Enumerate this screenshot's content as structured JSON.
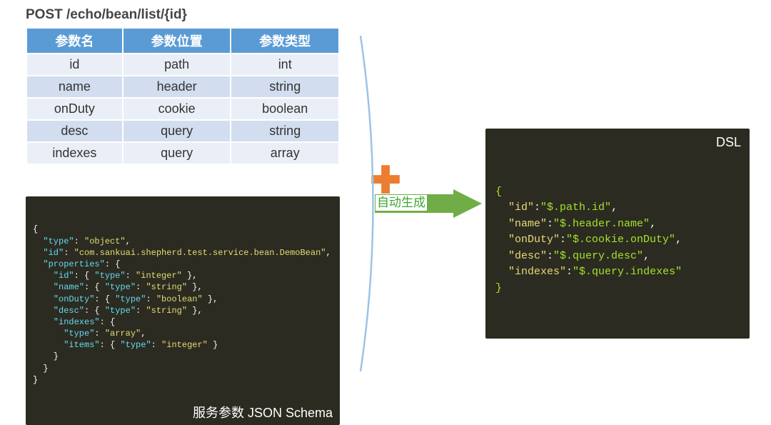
{
  "api_title": "POST /echo/bean/list/{id}",
  "table": {
    "headers": [
      "参数名",
      "参数位置",
      "参数类型"
    ],
    "rows": [
      {
        "name": "id",
        "location": "path",
        "type": "int"
      },
      {
        "name": "name",
        "location": "header",
        "type": "string"
      },
      {
        "name": "onDuty",
        "location": "cookie",
        "type": "boolean"
      },
      {
        "name": "desc",
        "location": "query",
        "type": "string"
      },
      {
        "name": "indexes",
        "location": "query",
        "type": "array"
      }
    ]
  },
  "plus_symbol": "✚",
  "json_schema": {
    "label": "服务参数 JSON Schema",
    "lines": [
      [
        {
          "t": "{",
          "c": "brace"
        }
      ],
      [
        {
          "t": "  \"type\"",
          "c": "key"
        },
        {
          "t": ": ",
          "c": "punct"
        },
        {
          "t": "\"object\"",
          "c": "str"
        },
        {
          "t": ",",
          "c": "punct"
        }
      ],
      [
        {
          "t": "  \"id\"",
          "c": "key"
        },
        {
          "t": ": ",
          "c": "punct"
        },
        {
          "t": "\"com.sankuai.shepherd.test.service.bean.DemoBean\"",
          "c": "str"
        },
        {
          "t": ",",
          "c": "punct"
        }
      ],
      [
        {
          "t": "  \"properties\"",
          "c": "key"
        },
        {
          "t": ": {",
          "c": "punct"
        }
      ],
      [
        {
          "t": "    \"id\"",
          "c": "key"
        },
        {
          "t": ": { ",
          "c": "punct"
        },
        {
          "t": "\"type\"",
          "c": "key"
        },
        {
          "t": ": ",
          "c": "punct"
        },
        {
          "t": "\"integer\"",
          "c": "str"
        },
        {
          "t": " },",
          "c": "punct"
        }
      ],
      [
        {
          "t": "    \"name\"",
          "c": "key"
        },
        {
          "t": ": { ",
          "c": "punct"
        },
        {
          "t": "\"type\"",
          "c": "key"
        },
        {
          "t": ": ",
          "c": "punct"
        },
        {
          "t": "\"string\"",
          "c": "str"
        },
        {
          "t": " },",
          "c": "punct"
        }
      ],
      [
        {
          "t": "    \"onDuty\"",
          "c": "key"
        },
        {
          "t": ": { ",
          "c": "punct"
        },
        {
          "t": "\"type\"",
          "c": "key"
        },
        {
          "t": ": ",
          "c": "punct"
        },
        {
          "t": "\"boolean\"",
          "c": "str"
        },
        {
          "t": " },",
          "c": "punct"
        }
      ],
      [
        {
          "t": "    \"desc\"",
          "c": "key"
        },
        {
          "t": ": { ",
          "c": "punct"
        },
        {
          "t": "\"type\"",
          "c": "key"
        },
        {
          "t": ": ",
          "c": "punct"
        },
        {
          "t": "\"string\"",
          "c": "str"
        },
        {
          "t": " },",
          "c": "punct"
        }
      ],
      [
        {
          "t": "    \"indexes\"",
          "c": "key"
        },
        {
          "t": ": {",
          "c": "punct"
        }
      ],
      [
        {
          "t": "      \"type\"",
          "c": "key"
        },
        {
          "t": ": ",
          "c": "punct"
        },
        {
          "t": "\"array\"",
          "c": "str"
        },
        {
          "t": ",",
          "c": "punct"
        }
      ],
      [
        {
          "t": "      \"items\"",
          "c": "key"
        },
        {
          "t": ": { ",
          "c": "punct"
        },
        {
          "t": "\"type\"",
          "c": "key"
        },
        {
          "t": ": ",
          "c": "punct"
        },
        {
          "t": "\"integer\"",
          "c": "str"
        },
        {
          "t": " }",
          "c": "punct"
        }
      ],
      [
        {
          "t": "    }",
          "c": "punct"
        }
      ],
      [
        {
          "t": "  }",
          "c": "punct"
        }
      ],
      [
        {
          "t": "}",
          "c": "brace"
        }
      ]
    ]
  },
  "arrow_label": "自动生成",
  "dsl": {
    "label": "DSL",
    "lines": [
      [
        {
          "t": "{",
          "c": "brace"
        }
      ],
      [
        {
          "t": "  \"id\"",
          "c": "key"
        },
        {
          "t": ":",
          "c": "punct"
        },
        {
          "t": "\"$.path.id\"",
          "c": "str"
        },
        {
          "t": ",",
          "c": "punct"
        }
      ],
      [
        {
          "t": "  \"name\"",
          "c": "key"
        },
        {
          "t": ":",
          "c": "punct"
        },
        {
          "t": "\"$.header.name\"",
          "c": "str"
        },
        {
          "t": ",",
          "c": "punct"
        }
      ],
      [
        {
          "t": "  \"onDuty\"",
          "c": "key"
        },
        {
          "t": ":",
          "c": "punct"
        },
        {
          "t": "\"$.cookie.onDuty\"",
          "c": "str"
        },
        {
          "t": ",",
          "c": "punct"
        }
      ],
      [
        {
          "t": "  \"desc\"",
          "c": "key"
        },
        {
          "t": ":",
          "c": "punct"
        },
        {
          "t": "\"$.query.desc\"",
          "c": "str"
        },
        {
          "t": ",",
          "c": "punct"
        }
      ],
      [
        {
          "t": "  \"indexes\"",
          "c": "key"
        },
        {
          "t": ":",
          "c": "punct"
        },
        {
          "t": "\"$.query.indexes\"",
          "c": "str"
        }
      ],
      [
        {
          "t": "}",
          "c": "brace"
        }
      ]
    ]
  }
}
